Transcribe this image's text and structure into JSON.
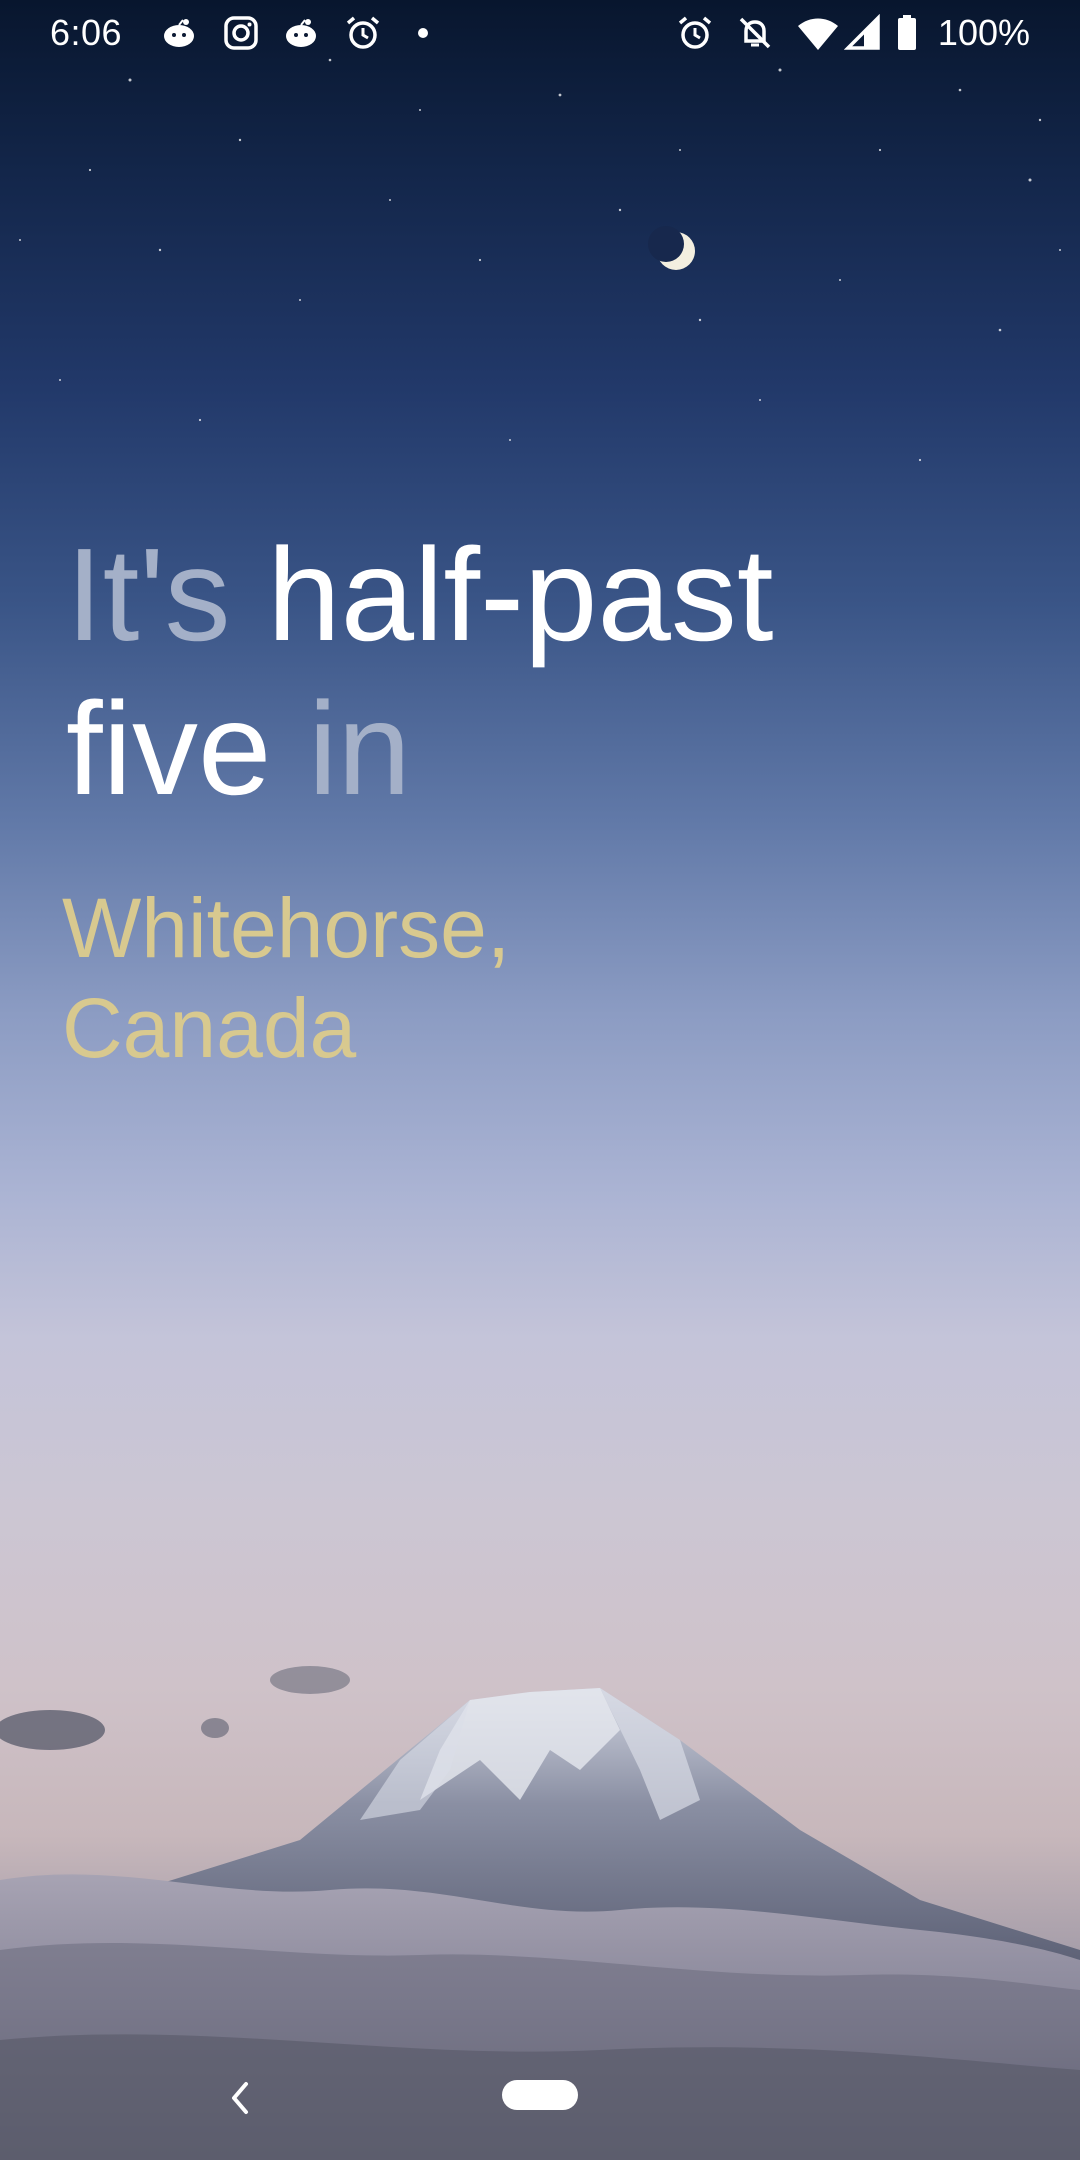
{
  "status_bar": {
    "time": "6:06",
    "notification_icons": [
      "reddit-icon",
      "instagram-icon",
      "reddit-icon",
      "alarm-icon",
      "more-dot-icon"
    ],
    "system_icons": [
      "alarm-icon",
      "do-not-disturb-icon",
      "wifi-icon",
      "signal-icon",
      "battery-icon"
    ],
    "battery_percent": "100%"
  },
  "headline": {
    "prefix": "It's",
    "time_words_line1": "half-past",
    "time_words_line2": "five",
    "suffix": "in"
  },
  "location": {
    "city": "Whitehorse,",
    "country": "Canada"
  },
  "colors": {
    "headline_bright": "#ffffff",
    "headline_dim": "#a4b0c8",
    "location": "#d8c98f"
  },
  "nav_bar": {
    "back_icon": "chevron-left-icon",
    "home_icon": "home-pill-icon"
  }
}
